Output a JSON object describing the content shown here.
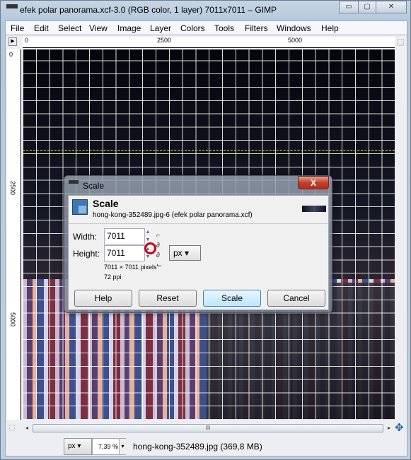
{
  "window": {
    "title": "efek polar panorama.xcf-3.0 (RGB color, 1 layer) 7011x7011 – GIMP",
    "minimize": "▭",
    "maximize": "▢",
    "close": "✕"
  },
  "menu": [
    "File",
    "Edit",
    "Select",
    "View",
    "Image",
    "Layer",
    "Colors",
    "Tools",
    "Filters",
    "Windows",
    "Help"
  ],
  "rulers": {
    "h": [
      "0",
      "2500",
      "5000"
    ],
    "v": [
      "0",
      "2500",
      "5000"
    ]
  },
  "dialog": {
    "title": "Scale",
    "close": "X",
    "heading": "Scale",
    "subtitle": "hong-kong-352489.jpg-6 (efek polar panorama.xcf)",
    "width_label": "Width:",
    "width_value": "7011",
    "height_label": "Height:",
    "height_value": "7011",
    "unit": "px ▾",
    "size_info": "7011 × 7011 pixels",
    "resolution": "72 ppi",
    "buttons": {
      "help": "Help",
      "reset": "Reset",
      "scale": "Scale",
      "cancel": "Cancel"
    },
    "highlight_color": "#c00018"
  },
  "scroll": {
    "grip": "III"
  },
  "status": {
    "unit": "px ▾",
    "zoom": "7,39 %",
    "dd": "▾",
    "text": "hong-kong-352489.jpg (369,8 MB)"
  }
}
